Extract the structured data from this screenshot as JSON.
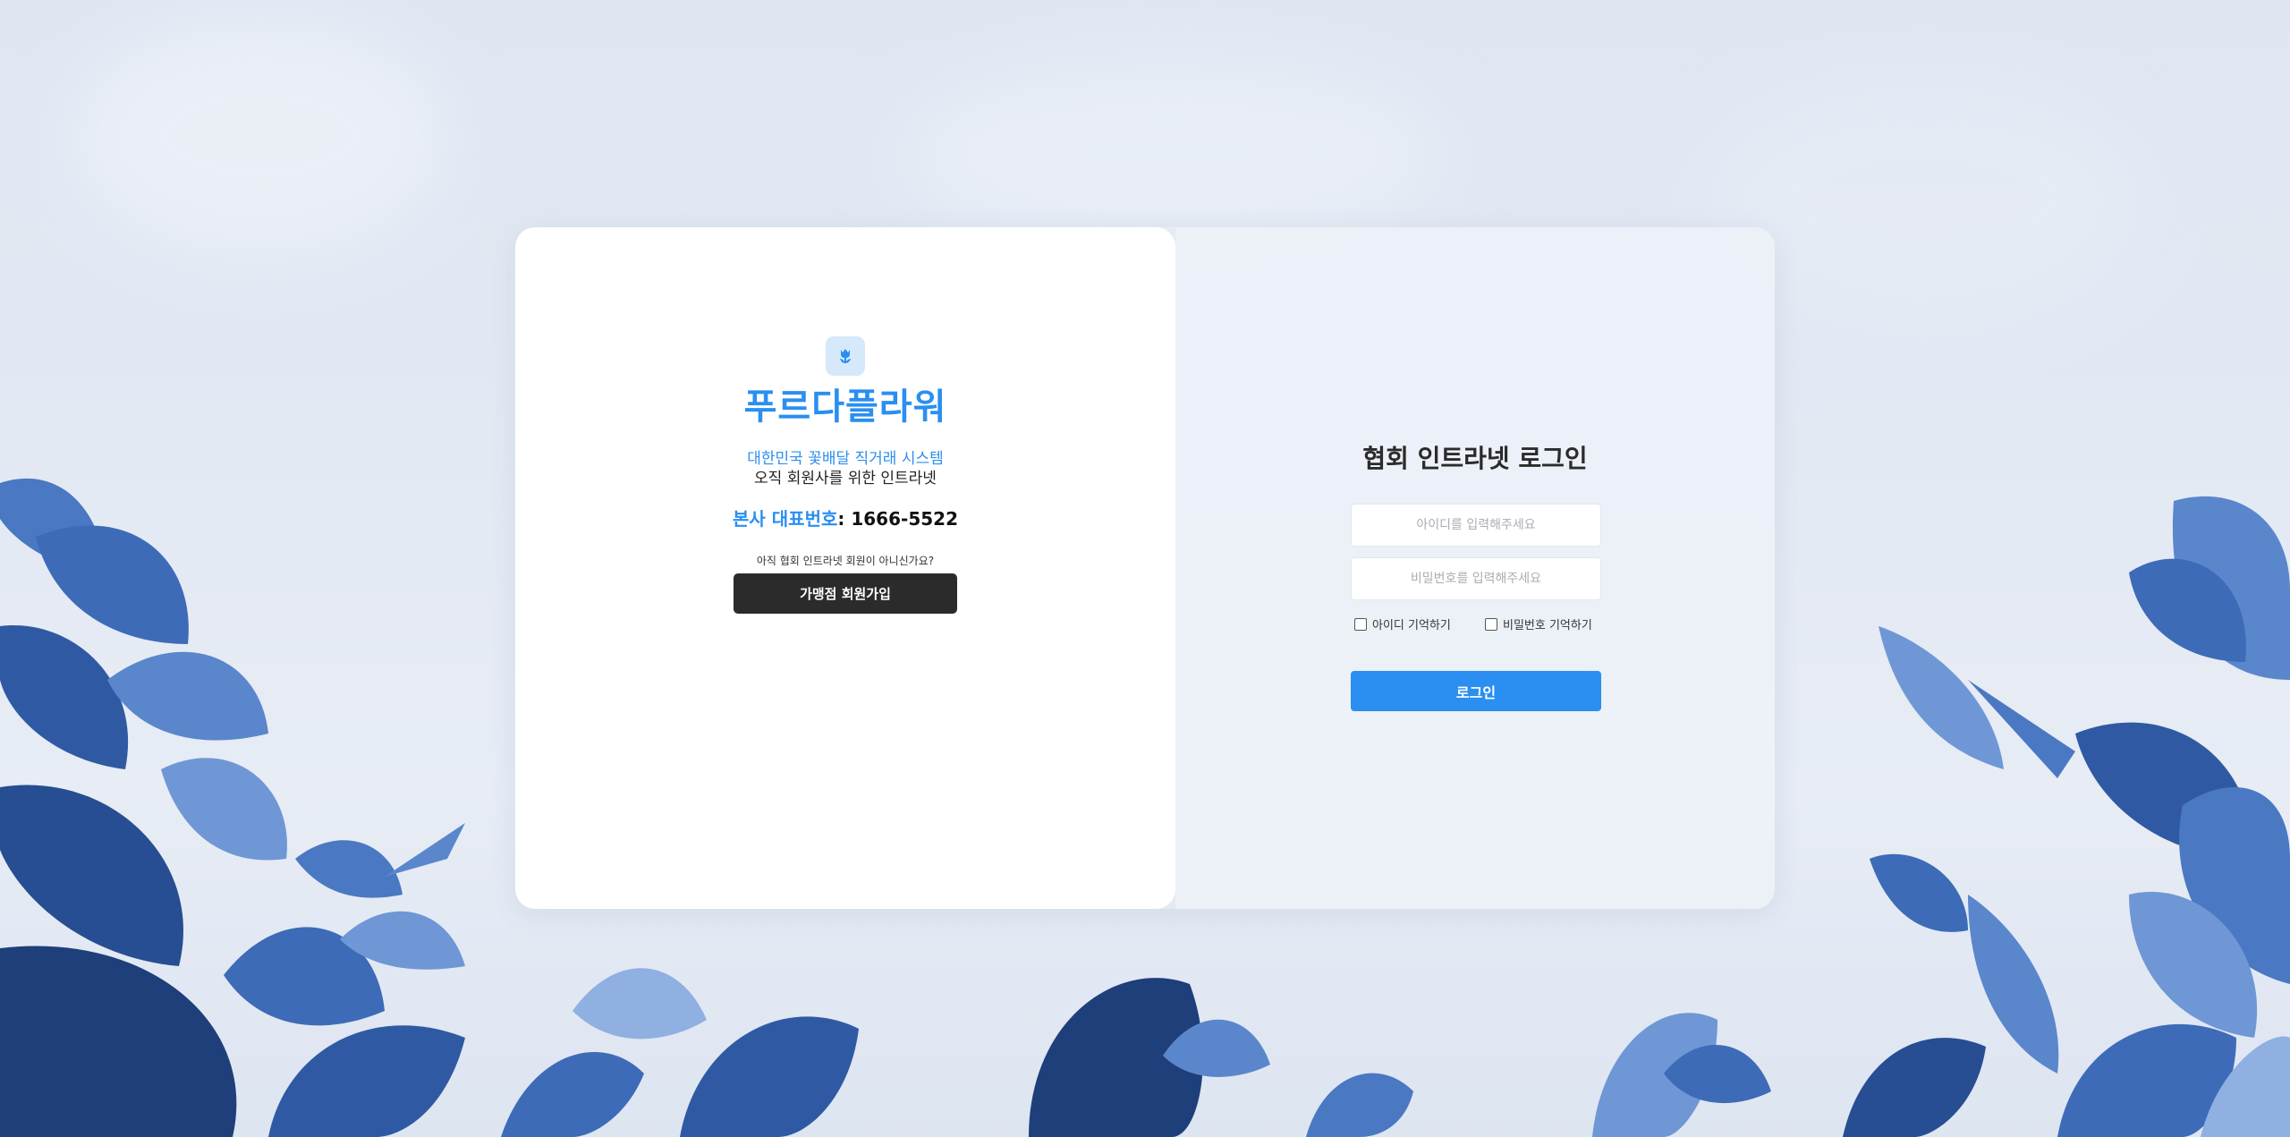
{
  "colors": {
    "accent": "#2a8ff0",
    "dark_button": "#2b2b2b",
    "leaf_blue": "#3d6bb8",
    "leaf_dark": "#1f3f7a",
    "leaf_light": "#8fb0e0"
  },
  "left_panel": {
    "icon": "flower-icon",
    "brand_name": "푸르다플라워",
    "tagline_1": "대한민국 꽃배달 직거래 시스템",
    "tagline_2": "오직 회원사를 위한 인트라넷",
    "phone_label": "본사 대표번호",
    "phone_number": ": 1666-5522",
    "signup_hint": "아직 협회 인트라넷 회원이 아니신가요?",
    "signup_button": "가맹점 회원가입"
  },
  "login": {
    "title": "협회 인트라넷 로그인",
    "id_placeholder": "아이디를 입력해주세요",
    "password_placeholder": "비밀번호를 입력해주세요",
    "remember_id": "아이디 기억하기",
    "remember_password": "비밀번호 기억하기",
    "login_button": "로그인"
  }
}
